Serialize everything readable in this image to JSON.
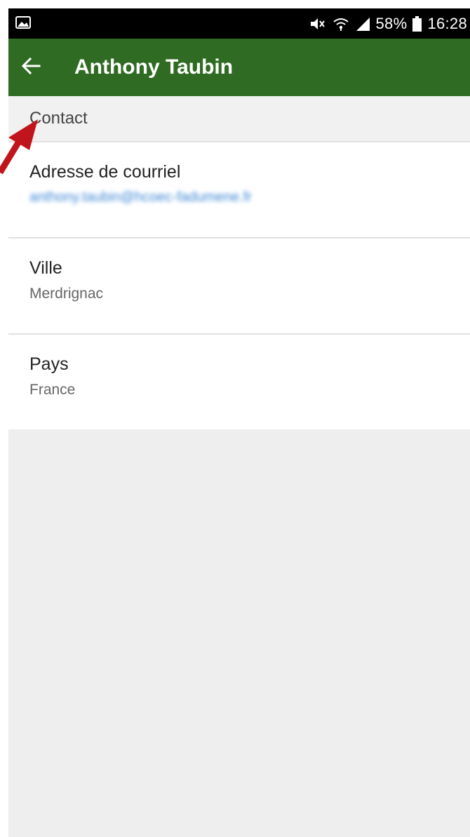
{
  "status_bar": {
    "battery_percent": "58%",
    "time": "16:28",
    "icons": [
      "image-icon",
      "mute-icon",
      "wifi-icon",
      "signal-icon",
      "battery-icon"
    ]
  },
  "app_bar": {
    "title": "Anthony Taubin",
    "back_icon": "arrow-left-icon",
    "background": "#2f6b22"
  },
  "section": {
    "title": "Contact"
  },
  "fields": [
    {
      "label": "Adresse de courriel",
      "value": "anthony.taubin@hcoec-fadumene.fr"
    },
    {
      "label": "Ville",
      "value": "Merdrignac"
    },
    {
      "label": "Pays",
      "value": "France"
    }
  ],
  "annotation": {
    "arrow_color": "#c0151d"
  }
}
